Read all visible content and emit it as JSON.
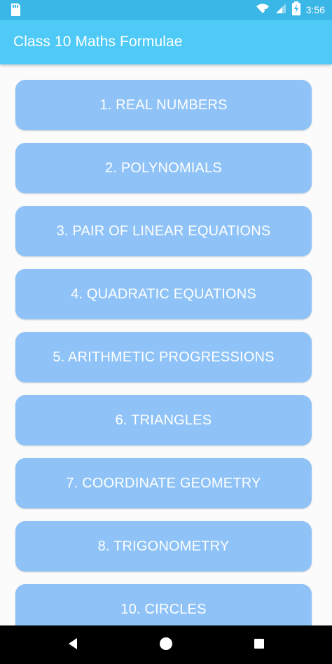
{
  "status": {
    "time": "3:56"
  },
  "app": {
    "title": "Class 10 Maths Formulae"
  },
  "chapters": [
    {
      "label": "1. REAL NUMBERS"
    },
    {
      "label": "2. POLYNOMIALS"
    },
    {
      "label": "3. PAIR OF LINEAR EQUATIONS"
    },
    {
      "label": "4. QUADRATIC EQUATIONS"
    },
    {
      "label": "5. ARITHMETIC PROGRESSIONS"
    },
    {
      "label": "6. TRIANGLES"
    },
    {
      "label": "7. COORDINATE GEOMETRY"
    },
    {
      "label": "8. TRIGONOMETRY"
    },
    {
      "label": "10. CIRCLES"
    }
  ],
  "colors": {
    "status_bar": "#3ab7e6",
    "app_bar": "#4fcaf7",
    "button_bg": "#8fc3f7",
    "button_text": "#ffffff",
    "background": "#fbfbfb"
  },
  "icons": {
    "status_left": "sd-card-icon",
    "wifi": "wifi-icon",
    "signal": "signal-icon",
    "battery": "battery-charging-icon",
    "nav_back": "back-triangle-icon",
    "nav_home": "home-circle-icon",
    "nav_recents": "recents-square-icon"
  }
}
